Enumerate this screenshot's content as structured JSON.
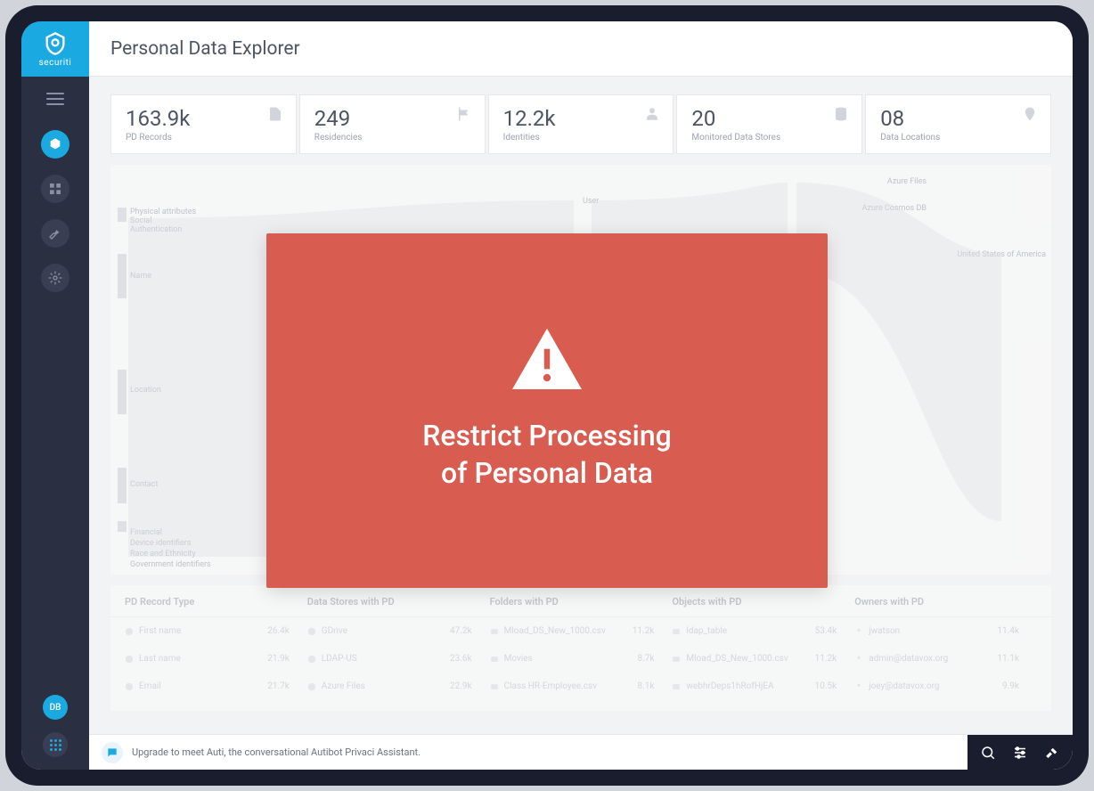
{
  "brand": {
    "name": "securiti"
  },
  "header": {
    "title": "Personal Data Explorer"
  },
  "stats": [
    {
      "value": "163.9k",
      "label": "PD Records"
    },
    {
      "value": "249",
      "label": "Residencies"
    },
    {
      "value": "12.2k",
      "label": "Identities"
    },
    {
      "value": "20",
      "label": "Monitored Data Stores"
    },
    {
      "value": "08",
      "label": "Data Locations"
    }
  ],
  "sankey": {
    "left_labels": [
      "Physical attributes",
      "Social",
      "Authentication",
      "Name",
      "Location",
      "Contact",
      "Financial",
      "Device identifiers",
      "Race and Ethnicity",
      "Government identifiers"
    ],
    "mid_labels": [
      "User"
    ],
    "right_labels": [
      "Azure Files",
      "Azure Cosmos DB",
      "United States of America"
    ]
  },
  "table": {
    "headers": [
      "PD Record Type",
      "Data Stores with PD",
      "Folders with PD",
      "Objects with PD",
      "Owners with PD"
    ],
    "rows": [
      {
        "c0": {
          "label": "First name",
          "count": "26.4k"
        },
        "c1": {
          "label": "GDrive",
          "count": "47.2k"
        },
        "c2": {
          "label": "Mload_DS_New_1000.csv",
          "count": "11.2k"
        },
        "c3": {
          "label": "ldap_table",
          "count": "53.4k"
        },
        "c4": {
          "label": "jwatson",
          "count": "11.4k"
        }
      },
      {
        "c0": {
          "label": "Last name",
          "count": "21.9k"
        },
        "c1": {
          "label": "LDAP-US",
          "count": "23.6k"
        },
        "c2": {
          "label": "Movies",
          "count": "8.7k"
        },
        "c3": {
          "label": "Mload_DS_New_1000.csv",
          "count": "11.2k"
        },
        "c4": {
          "label": "admin@datavox.org",
          "count": "11.1k"
        }
      },
      {
        "c0": {
          "label": "Email",
          "count": "21.7k"
        },
        "c1": {
          "label": "Azure Files",
          "count": "22.9k"
        },
        "c2": {
          "label": "Class HR-Employee.csv",
          "count": "8.1k"
        },
        "c3": {
          "label": "webhrDeps1hRofHjEA",
          "count": "10.5k"
        },
        "c4": {
          "label": "joey@datavox.org",
          "count": "9.9k"
        }
      }
    ]
  },
  "chat": {
    "prompt": "Upgrade to meet Auti, the conversational Autibot Privaci Assistant."
  },
  "sidebar": {
    "avatar_initials": "DB"
  },
  "overlay": {
    "line1": "Restrict Processing",
    "line2": "of Personal Data"
  }
}
